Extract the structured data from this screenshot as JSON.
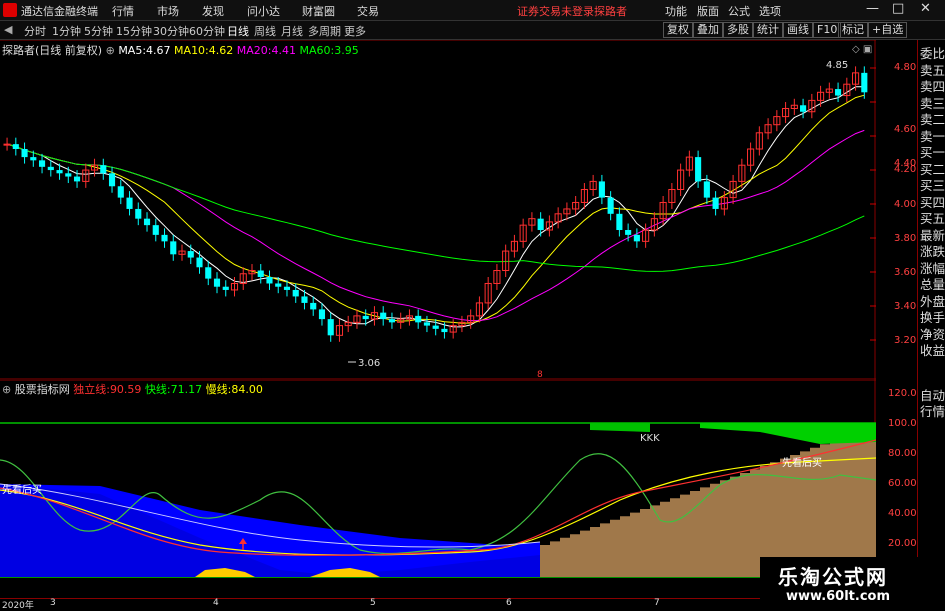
{
  "menubar": {
    "app_title": "通达信金融终端",
    "items": [
      "行情",
      "市场",
      "发现",
      "问小达",
      "财富圈",
      "交易"
    ],
    "login_text": "证券交易未登录",
    "user": "探路者",
    "right_items": [
      "功能",
      "版面",
      "公式",
      "选项"
    ],
    "win_min": "—",
    "win_max": "□",
    "win_close": "✕"
  },
  "toolbar": {
    "periods": [
      "分时",
      "1分钟",
      "5分钟",
      "15分钟",
      "30分钟",
      "60分钟",
      "日线",
      "周线",
      "月线",
      "多周期",
      "更多"
    ],
    "active_period": "日线",
    "right_buttons": [
      "复权",
      "叠加",
      "多股",
      "统计",
      "画线",
      "F10",
      "标记",
      "+自选"
    ],
    "back_icon": "◀"
  },
  "main_chart": {
    "header_title": "探路者(日线 前复权)",
    "ma": [
      {
        "label": "MA5:",
        "value": "4.67",
        "color": "#ffffff"
      },
      {
        "label": "MA10:",
        "value": "4.62",
        "color": "#ffff00"
      },
      {
        "label": "MA20:",
        "value": "4.41",
        "color": "#ff00ff"
      },
      {
        "label": "MA60:",
        "value": "3.95",
        "color": "#00ff00"
      }
    ],
    "high_label": "4.85",
    "low_label": "3.06",
    "price_ticks": [
      "4.80",
      "4.60",
      "4.40",
      "4.20",
      "4.00",
      "3.80",
      "3.60",
      "3.40",
      "3.20"
    ],
    "price_range": [
      3.06,
      4.85
    ]
  },
  "indicator": {
    "name": "股票指标网",
    "lines": [
      {
        "label": "独立线:",
        "value": "90.59",
        "color": "#ff3030"
      },
      {
        "label": "快线:",
        "value": "71.17",
        "color": "#00ff00"
      },
      {
        "label": "慢线:",
        "value": "84.00",
        "color": "#ffff00"
      }
    ],
    "text_kkk": "KKK",
    "text_left": "先看后买",
    "text_right": "先看后买",
    "ticks": [
      "120.0",
      "100.0",
      "80.00",
      "60.00",
      "40.00",
      "20.00"
    ]
  },
  "date_axis": [
    "2020年",
    "3",
    "4",
    "5",
    "6",
    "7"
  ],
  "right_panel": {
    "top": [
      "委比",
      "卖五",
      "卖四",
      "卖三",
      "卖二",
      "卖一",
      "买一",
      "买二",
      "买三",
      "买四",
      "买五",
      "最新",
      "涨跌",
      "涨幅",
      "总量",
      "外盘",
      "换手",
      "净资",
      "收益"
    ],
    "bottom": [
      "自动",
      "行情"
    ]
  },
  "watermark": {
    "title": "乐淘公式网",
    "url": "www.60lt.com"
  },
  "colors": {
    "up": "#ff3030",
    "down": "#00ffff",
    "grid": "#800000"
  }
}
